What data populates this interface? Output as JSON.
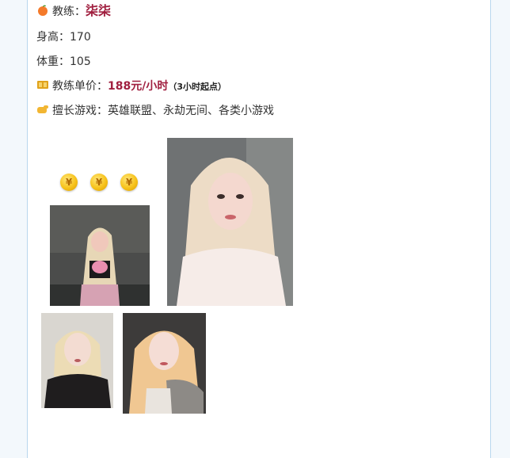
{
  "profile": {
    "coach_label": "教练：",
    "coach_name": "柒柒",
    "height_text": "身高：170",
    "weight_text": "体重：105",
    "price_label": "教练单价：",
    "price_value": "188元/小时",
    "price_note": "（3小时起点）",
    "games_text": "擅长游戏：英雄联盟、永劫无间、各类小游戏"
  },
  "coins": [
    "¥",
    "¥",
    "¥"
  ],
  "colors": {
    "accent": "#a01f3f",
    "border": "#b9d7ee",
    "page_bg": "#f3f8fc"
  }
}
